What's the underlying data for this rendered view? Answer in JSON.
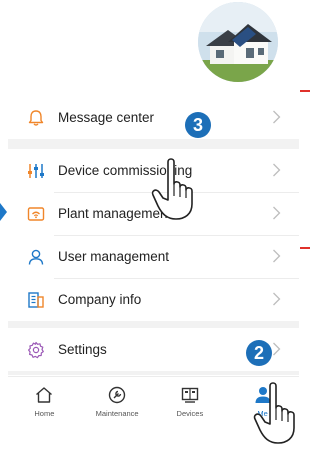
{
  "menu": {
    "group1": [
      {
        "label": "Message center",
        "icon": "bell-icon"
      }
    ],
    "group2": [
      {
        "label": "Device commissioning",
        "icon": "sliders-icon"
      },
      {
        "label": "Plant management",
        "icon": "router-icon"
      },
      {
        "label": "User management",
        "icon": "user-icon"
      },
      {
        "label": "Company info",
        "icon": "building-icon"
      }
    ],
    "group3": [
      {
        "label": "Settings",
        "icon": "gear-icon"
      }
    ]
  },
  "tabs": [
    {
      "label": "Home",
      "icon": "home-icon"
    },
    {
      "label": "Maintenance",
      "icon": "wrench-icon"
    },
    {
      "label": "Devices",
      "icon": "devices-icon"
    },
    {
      "label": "Me",
      "icon": "person-icon"
    }
  ],
  "callouts": {
    "step_a": "3",
    "step_b": "2"
  },
  "colors": {
    "accent_orange": "#f0862a",
    "accent_blue": "#1e78c8",
    "callout_blue": "#1d6fb8",
    "mark_red": "#e0312b"
  }
}
